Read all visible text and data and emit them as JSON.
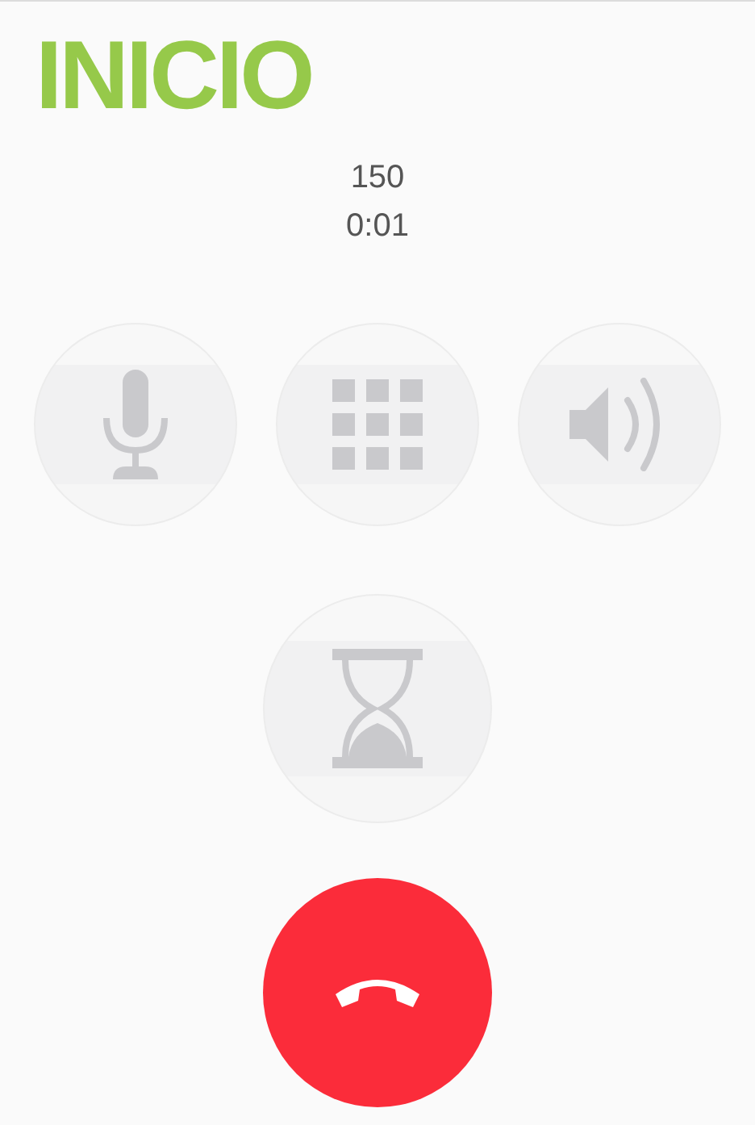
{
  "logo": "INICIO",
  "call": {
    "number": "150",
    "duration": "0:01"
  },
  "controls": [
    {
      "kind": "mute",
      "disabled": true
    },
    {
      "kind": "keypad",
      "disabled": true
    },
    {
      "kind": "speaker",
      "disabled": true
    }
  ],
  "hold": {
    "kind": "hold",
    "disabled": true
  },
  "end_call": {
    "kind": "end-call"
  }
}
